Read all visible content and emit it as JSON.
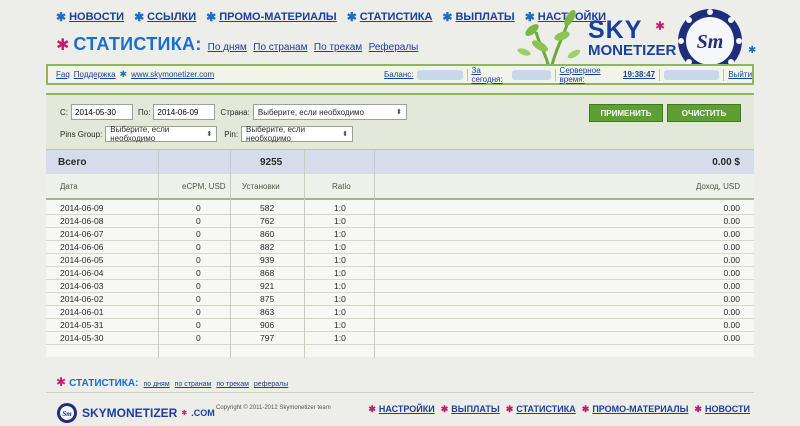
{
  "top_nav": [
    "НОВОСТИ",
    "ССЫЛКИ",
    "ПРОМО-МАТЕРИАЛЫ",
    "СТАТИСТИКА",
    "ВЫПЛАТЫ",
    "НАСТРОЙКИ"
  ],
  "page": {
    "title": "СТАТИСТИКА:",
    "subnav": [
      "По дням",
      "По странам",
      "По трекам",
      "Рефералы"
    ]
  },
  "logo": {
    "line1": "SKY",
    "line2": "MONETIZER",
    "badge": "Sm"
  },
  "info_bar": {
    "faq": "Faq",
    "support": "Поддержка",
    "site": "www.skymonetizer.com",
    "balance_label": "Баланс:",
    "today_label": "За сегодня:",
    "server_time_label": "Серверное время:",
    "server_time": "19:38:47",
    "logout": "Выйти"
  },
  "filters": {
    "from_label": "С:",
    "from_value": "2014-05-30",
    "to_label": "По:",
    "to_value": "2014-06-09",
    "country_label": "Страна:",
    "country_value": "Выберите, если необходимо",
    "pins_group_label": "Pins Group:",
    "pins_group_value": "Выберите, если необходимо",
    "pin_label": "Pin:",
    "pin_value": "Выберите, если необходимо",
    "apply_label": "ПРИМЕНИТЬ",
    "clear_label": "ОЧИСТИТЬ"
  },
  "table": {
    "total": {
      "label": "Всего",
      "installs": "9255",
      "income": "0.00 $"
    },
    "headers": [
      "Дата",
      "eCPM, USD",
      "Установки",
      "Ratio",
      "Доход, USD"
    ],
    "rows": [
      [
        "2014-06-09",
        "0",
        "582",
        "1:0",
        "0.00"
      ],
      [
        "2014-06-08",
        "0",
        "762",
        "1:0",
        "0.00"
      ],
      [
        "2014-06-07",
        "0",
        "860",
        "1:0",
        "0.00"
      ],
      [
        "2014-06-06",
        "0",
        "882",
        "1:0",
        "0.00"
      ],
      [
        "2014-06-05",
        "0",
        "939",
        "1:0",
        "0.00"
      ],
      [
        "2014-06-04",
        "0",
        "868",
        "1:0",
        "0.00"
      ],
      [
        "2014-06-03",
        "0",
        "921",
        "1:0",
        "0.00"
      ],
      [
        "2014-06-02",
        "0",
        "875",
        "1:0",
        "0.00"
      ],
      [
        "2014-06-01",
        "0",
        "863",
        "1:0",
        "0.00"
      ],
      [
        "2014-05-31",
        "0",
        "906",
        "1:0",
        "0.00"
      ],
      [
        "2014-05-30",
        "0",
        "797",
        "1:0",
        "0.00"
      ]
    ]
  },
  "bottom": {
    "title": "СТАТИСТИКА:",
    "links": [
      "по дням",
      "по странам",
      "по трекам",
      "рефералы"
    ]
  },
  "footer": {
    "logo_text": "SKYMONETIZER",
    "logo_suffix": ".COM",
    "copyright": "Copyright © 2011-2012 Skymonetizer team",
    "nav": [
      "НАСТРОЙКИ",
      "ВЫПЛАТЫ",
      "СТАТИСТИКА",
      "ПРОМО-МАТЕРИАЛЫ",
      "НОВОСТИ"
    ]
  },
  "colors": {
    "accent_blue": "#1b6fcc",
    "link_blue": "#1a3f9c",
    "green": "#5e9e35",
    "pink": "#c01e6e"
  }
}
